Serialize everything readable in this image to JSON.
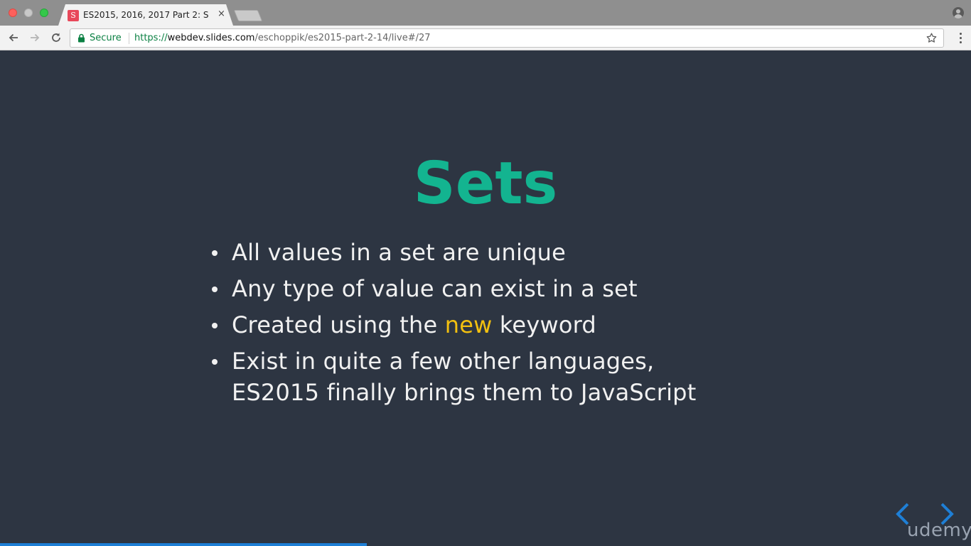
{
  "browser": {
    "tab_title": "ES2015, 2016, 2017 Part 2: S",
    "tab_favicon_letter": "S",
    "tab_close_glyph": "×",
    "security_label": "Secure",
    "url_scheme": "https://",
    "url_host": "webdev.slides.com",
    "url_path": "/eschoppik/es2015-part-2-14/live#/27"
  },
  "slide": {
    "title": "Sets",
    "bullets": [
      "All values in a set are unique",
      "Any type of value can exist in a set",
      {
        "before": "Created using the ",
        "keyword": "new",
        "after": " keyword"
      },
      {
        "line1": "Exist in quite a few other languages,",
        "line2": "ES2015 finally brings them to JavaScript"
      }
    ],
    "progress_fraction": 0.378
  },
  "watermark": "udemy",
  "colors": {
    "slide_bg": "#2d3542",
    "title": "#13b490",
    "keyword": "#f2c010",
    "text": "#f1f1f1",
    "secure_green": "#0b8043",
    "progress": "#1e7fd6"
  },
  "icons": [
    "close-window-icon",
    "minimize-window-icon",
    "maximize-window-icon",
    "profile-icon",
    "back-arrow-icon",
    "forward-arrow-icon",
    "reload-icon",
    "lock-icon",
    "star-icon",
    "menu-icon",
    "chevron-left-icon",
    "chevron-right-icon"
  ]
}
